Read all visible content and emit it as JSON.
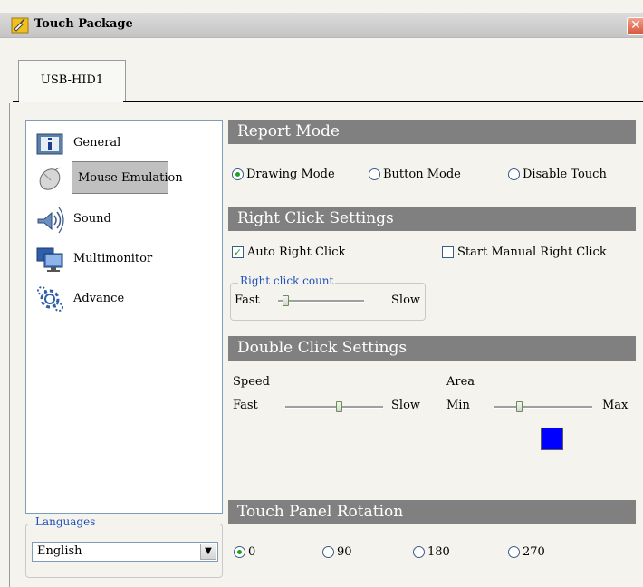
{
  "window": {
    "title": "Touch Package"
  },
  "tabs": [
    "USB-HID1"
  ],
  "nav": {
    "items": [
      {
        "label": "General",
        "icon": "info-icon"
      },
      {
        "label": "Mouse Emulation",
        "icon": "mouse-icon",
        "selected": true
      },
      {
        "label": "Sound",
        "icon": "speaker-icon"
      },
      {
        "label": "Multimonitor",
        "icon": "monitors-icon"
      },
      {
        "label": "Advance",
        "icon": "gears-icon"
      }
    ]
  },
  "languages": {
    "label": "Languages",
    "selected": "English"
  },
  "report_mode": {
    "title": "Report Mode",
    "options": [
      "Drawing Mode",
      "Button Mode",
      "Disable Touch"
    ],
    "selected": "Drawing Mode"
  },
  "right_click": {
    "title": "Right Click Settings",
    "auto_label": "Auto Right Click",
    "auto_checked": true,
    "manual_label": "Start Manual Right Click",
    "manual_checked": false,
    "count_label": "Right click count",
    "fast": "Fast",
    "slow": "Slow",
    "count_level": 0.08
  },
  "double_click": {
    "title": "Double Click Settings",
    "speed_label": "Speed",
    "fast": "Fast",
    "slow": "Slow",
    "speed_level": 0.55,
    "area_label": "Area",
    "min": "Min",
    "max": "Max",
    "area_level": 0.25,
    "area_color": "#0000ff"
  },
  "rotation": {
    "title": "Touch Panel Rotation",
    "options": [
      "0",
      "90",
      "180",
      "270"
    ],
    "selected": "0"
  }
}
